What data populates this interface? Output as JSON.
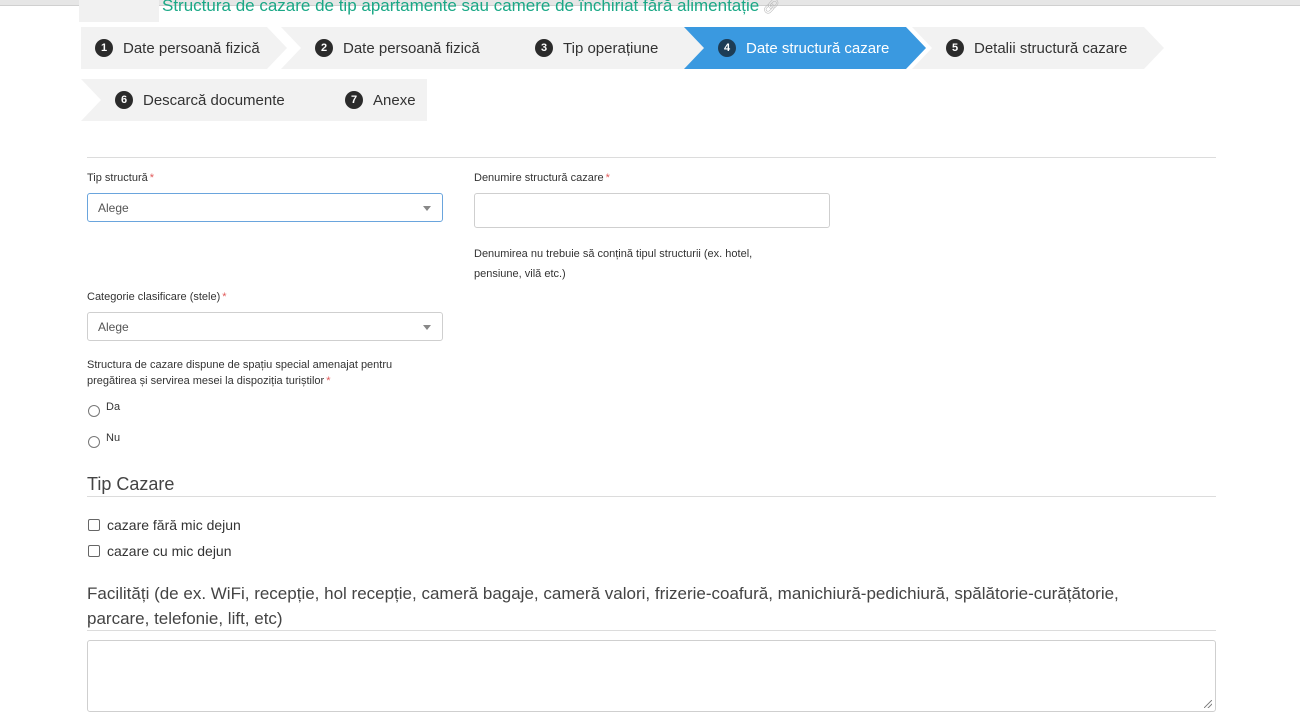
{
  "page": {
    "title": "Structura de cazare de tip apartamente sau camere de închiriat fără alimentație",
    "title_icon": "link-icon"
  },
  "steps": [
    {
      "num": "1",
      "label": "Date persoană fizică"
    },
    {
      "num": "2",
      "label": "Date persoană fizică"
    },
    {
      "num": "3",
      "label": "Tip operațiune"
    },
    {
      "num": "4",
      "label": "Date structură cazare",
      "active": true
    },
    {
      "num": "5",
      "label": "Detalii structură cazare"
    },
    {
      "num": "6",
      "label": "Descarcă documente"
    },
    {
      "num": "7",
      "label": "Anexe"
    }
  ],
  "form": {
    "tip_structura": {
      "label": "Tip structură",
      "required_mark": "*",
      "value": "Alege"
    },
    "denumire": {
      "label": "Denumire structură cazare",
      "required_mark": "*",
      "value": "",
      "help_line1": "Denumirea nu trebuie să conțină tipul structurii (ex. hotel,",
      "help_line2": "pensiune, vilă etc.)"
    },
    "categorie": {
      "label": "Categorie clasificare (stele)",
      "required_mark": "*",
      "value": "Alege"
    },
    "spatiu_masa": {
      "question_line1": "Structura de cazare dispune de spațiu special amenajat pentru",
      "question_line2": "pregătirea și servirea mesei la dispoziția turiștilor",
      "required_mark": "*",
      "options": [
        "Da",
        "Nu"
      ]
    }
  },
  "tip_cazare": {
    "title": "Tip Cazare",
    "options": [
      "cazare fără mic dejun",
      "cazare cu mic dejun"
    ]
  },
  "facilitati": {
    "title_line1": "Facilități (de ex. WiFi, recepție, hol recepție, cameră bagaje, cameră valori, frizerie-coafură, manichiură-pedichiură, spălătorie-curățătorie,",
    "title_line2": "parcare, telefonie, lift, etc)",
    "value": ""
  },
  "colors": {
    "accent": "#3a99e0",
    "title": "#1aa886",
    "required": "#e15a5a"
  }
}
